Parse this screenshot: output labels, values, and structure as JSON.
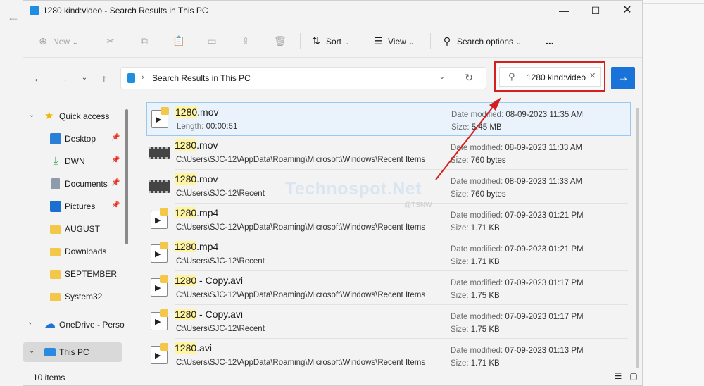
{
  "window": {
    "title": "1280 kind:video - Search Results in This PC"
  },
  "toolbar": {
    "new": "New",
    "sort": "Sort",
    "view": "View",
    "search_options": "Search options",
    "more": "..."
  },
  "address": {
    "path": "Search Results in This PC"
  },
  "search": {
    "query": "1280 kind:video"
  },
  "sidebar": {
    "quick_access": "Quick access",
    "items": [
      "Desktop",
      "DWN",
      "Documents",
      "Pictures",
      "AUGUST",
      "Downloads",
      "SEPTEMBER",
      "System32"
    ],
    "onedrive": "OneDrive - Perso",
    "this_pc": "This PC"
  },
  "results": [
    {
      "highlight": "1280",
      "rest": ".mov",
      "line2_key": "Length:",
      "line2_val": "00:00:51",
      "date_key": "Date modified:",
      "date": "08-09-2023 11:35 AM",
      "size_key": "Size:",
      "size": "5.45 MB",
      "thumb": "video-icon"
    },
    {
      "highlight": "1280",
      "rest": ".mov",
      "line2_val": "C:\\Users\\SJC-12\\AppData\\Roaming\\Microsoft\\Windows\\Recent Items",
      "date_key": "Date modified:",
      "date": "08-09-2023 11:33 AM",
      "size_key": "Size:",
      "size": "760 bytes",
      "thumb": "film-icon"
    },
    {
      "highlight": "1280",
      "rest": ".mov",
      "line2_val": "C:\\Users\\SJC-12\\Recent",
      "date_key": "Date modified:",
      "date": "08-09-2023 11:33 AM",
      "size_key": "Size:",
      "size": "760 bytes",
      "thumb": "film-icon"
    },
    {
      "highlight": "1280",
      "rest": ".mp4",
      "line2_val": "C:\\Users\\SJC-12\\AppData\\Roaming\\Microsoft\\Windows\\Recent Items",
      "date_key": "Date modified:",
      "date": "07-09-2023 01:21 PM",
      "size_key": "Size:",
      "size": "1.71 KB",
      "thumb": "video-icon"
    },
    {
      "highlight": "1280",
      "rest": ".mp4",
      "line2_val": "C:\\Users\\SJC-12\\Recent",
      "date_key": "Date modified:",
      "date": "07-09-2023 01:21 PM",
      "size_key": "Size:",
      "size": "1.71 KB",
      "thumb": "video-icon"
    },
    {
      "highlight": "1280",
      "rest": " - Copy.avi",
      "line2_val": "C:\\Users\\SJC-12\\AppData\\Roaming\\Microsoft\\Windows\\Recent Items",
      "date_key": "Date modified:",
      "date": "07-09-2023 01:17 PM",
      "size_key": "Size:",
      "size": "1.75 KB",
      "thumb": "video-icon"
    },
    {
      "highlight": "1280",
      "rest": " - Copy.avi",
      "line2_val": "C:\\Users\\SJC-12\\Recent",
      "date_key": "Date modified:",
      "date": "07-09-2023 01:17 PM",
      "size_key": "Size:",
      "size": "1.75 KB",
      "thumb": "video-icon"
    },
    {
      "highlight": "1280",
      "rest": ".avi",
      "line2_val": "C:\\Users\\SJC-12\\AppData\\Roaming\\Microsoft\\Windows\\Recent Items",
      "date_key": "Date modified:",
      "date": "07-09-2023 01:13 PM",
      "size_key": "Size:",
      "size": "1.71 KB",
      "thumb": "video-icon"
    }
  ],
  "status": {
    "count": "10 items"
  },
  "watermark": {
    "text": "Technospot.Net",
    "sub": "@TSNW"
  },
  "colors": {
    "accent": "#1a73d9",
    "highlight": "#fff4a0",
    "annotation": "#d51f1f"
  }
}
